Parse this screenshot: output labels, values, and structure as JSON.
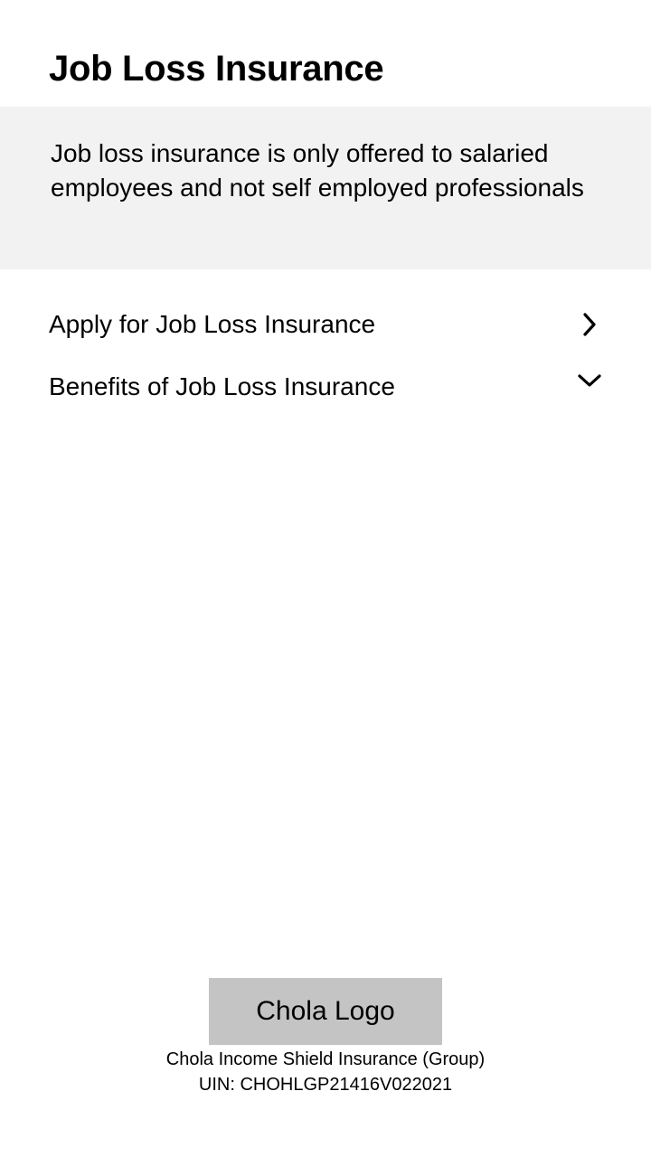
{
  "page": {
    "title": "Job Loss Insurance"
  },
  "notice": {
    "text": "Job loss insurance is only offered to salaried employees and not self employed professionals"
  },
  "options": {
    "apply": {
      "label": "Apply for Job Loss Insurance",
      "icon": "chevron-right-icon"
    },
    "benefits": {
      "label": "Benefits of Job Loss Insurance",
      "icon": "chevron-down-icon"
    }
  },
  "footer": {
    "logo_label": "Chola Logo",
    "product_name": "Chola Income Shield Insurance (Group)",
    "uin": "UIN: CHOHLGP21416V022021"
  },
  "colors": {
    "notice_bg": "#f2f2f2",
    "logo_placeholder_bg": "#c4c4c4",
    "text": "#000000"
  }
}
